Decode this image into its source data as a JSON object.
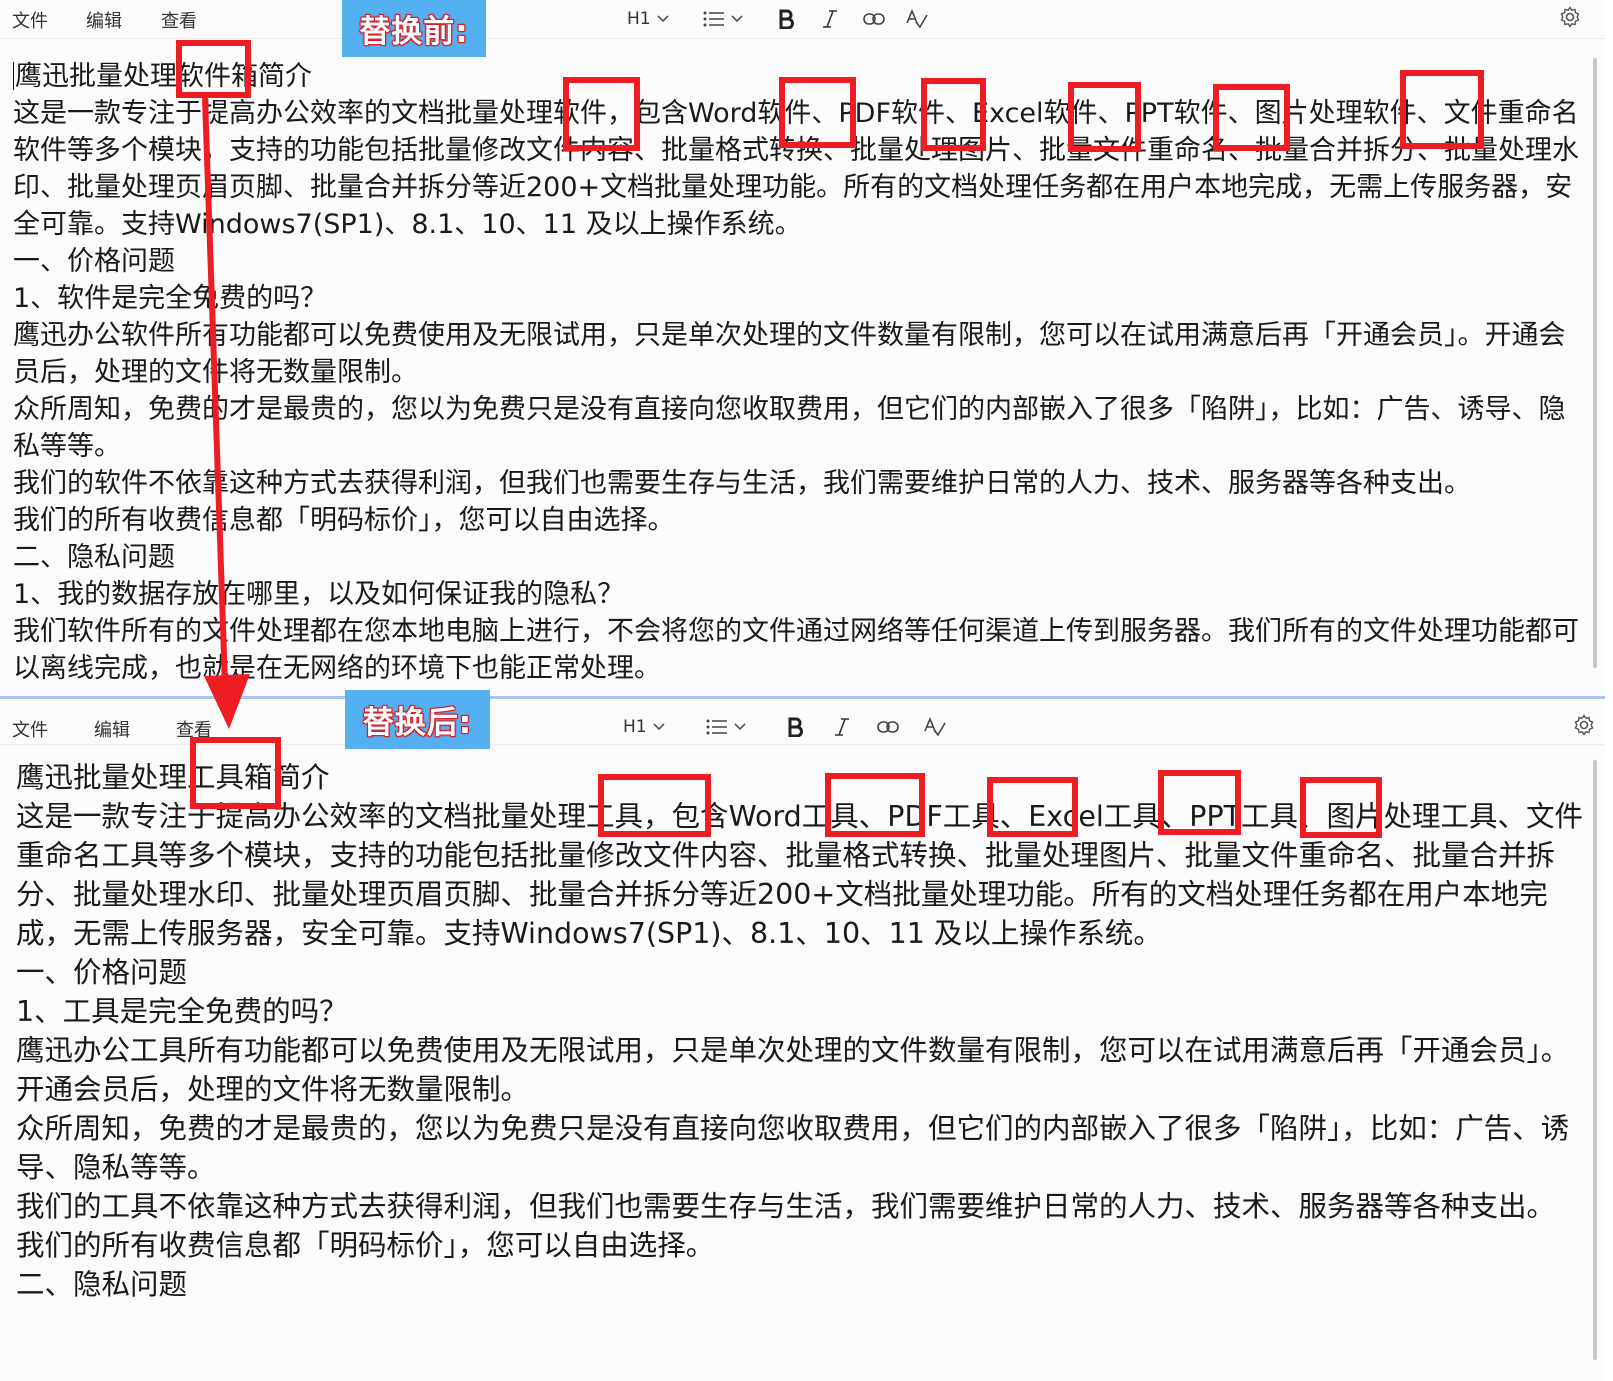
{
  "menus": {
    "file": "文件",
    "edit": "编辑",
    "view": "查看"
  },
  "toolbar": {
    "heading": "H1"
  },
  "labels": {
    "before": "替换前:",
    "after": "替换后:"
  },
  "icons": [
    "chevron-down-icon",
    "list-icon",
    "bold-icon",
    "italic-icon",
    "link-icon",
    "spellcheck-icon",
    "gear-icon"
  ],
  "colors": {
    "highlight": "#ee1d23",
    "tag_bg": "#55b0f2",
    "arrow": "#ee1d23",
    "divider": "#a9c7ee"
  },
  "before": {
    "lines": [
      "鹰迅批量处理软件箱简介",
      "这是一款专注于提高办公效率的文档批量处理软件，包含Word软件、PDF软件、Excel软件、PPT软件、图片处理软件、文件重命名软件等多个模块，支持的功能包括批量修改文件内容、批量格式转换、批量处理图片、批量文件重命名、批量合并拆分、批量处理水印、批量处理页眉页脚、批量合并拆分等近200+文档批量处理功能。所有的文档处理任务都在用户本地完成，无需上传服务器，安全可靠。支持Windows7(SP1)、8.1、10、11 及以上操作系统。",
      "一、价格问题",
      "1、软件是完全免费的吗？",
      "鹰迅办公软件所有功能都可以免费使用及无限试用，只是单次处理的文件数量有限制，您可以在试用满意后再「开通会员」。开通会员后，处理的文件将无数量限制。",
      "众所周知，免费的才是最贵的，您以为免费只是没有直接向您收取费用，但它们的内部嵌入了很多「陷阱」，比如：广告、诱导、隐私等等。",
      "我们的软件不依靠这种方式去获得利润，但我们也需要生存与生活，我们需要维护日常的人力、技术、服务器等各种支出。",
      "我们的所有收费信息都「明码标价」，您可以自由选择。",
      "二、隐私问题",
      "1、我的数据存放在哪里，以及如何保证我的隐私？",
      "我们软件所有的文件处理都在您本地电脑上进行，不会将您的文件通过网络等任何渠道上传到服务器。我们所有的文件处理功能都可以离线完成，也就是在无网络的环境下也能正常处理。"
    ]
  },
  "after": {
    "lines": [
      "鹰迅批量处理工具箱简介",
      "这是一款专注于提高办公效率的文档批量处理工具，包含Word工具、PDF工具、Excel工具、PPT工具、图片处理工具、文件重命名工具等多个模块，支持的功能包括批量修改文件内容、批量格式转换、批量处理图片、批量文件重命名、批量合并拆分、批量处理水印、批量处理页眉页脚、批量合并拆分等近200+文档批量处理功能。所有的文档处理任务都在用户本地完成，无需上传服务器，安全可靠。支持Windows7(SP1)、8.1、10、11 及以上操作系统。",
      "一、价格问题",
      "1、工具是完全免费的吗？",
      "鹰迅办公工具所有功能都可以免费使用及无限试用，只是单次处理的文件数量有限制，您可以在试用满意后再「开通会员」。开通会员后，处理的文件将无数量限制。",
      "众所周知，免费的才是最贵的，您以为免费只是没有直接向您收取费用，但它们的内部嵌入了很多「陷阱」，比如：广告、诱导、隐私等等。",
      "我们的工具不依靠这种方式去获得利润，但我们也需要生存与生活，我们需要维护日常的人力、技术、服务器等各种支出。",
      "我们的所有收费信息都「明码标价」，您可以自由选择。",
      "二、隐私问题"
    ]
  }
}
